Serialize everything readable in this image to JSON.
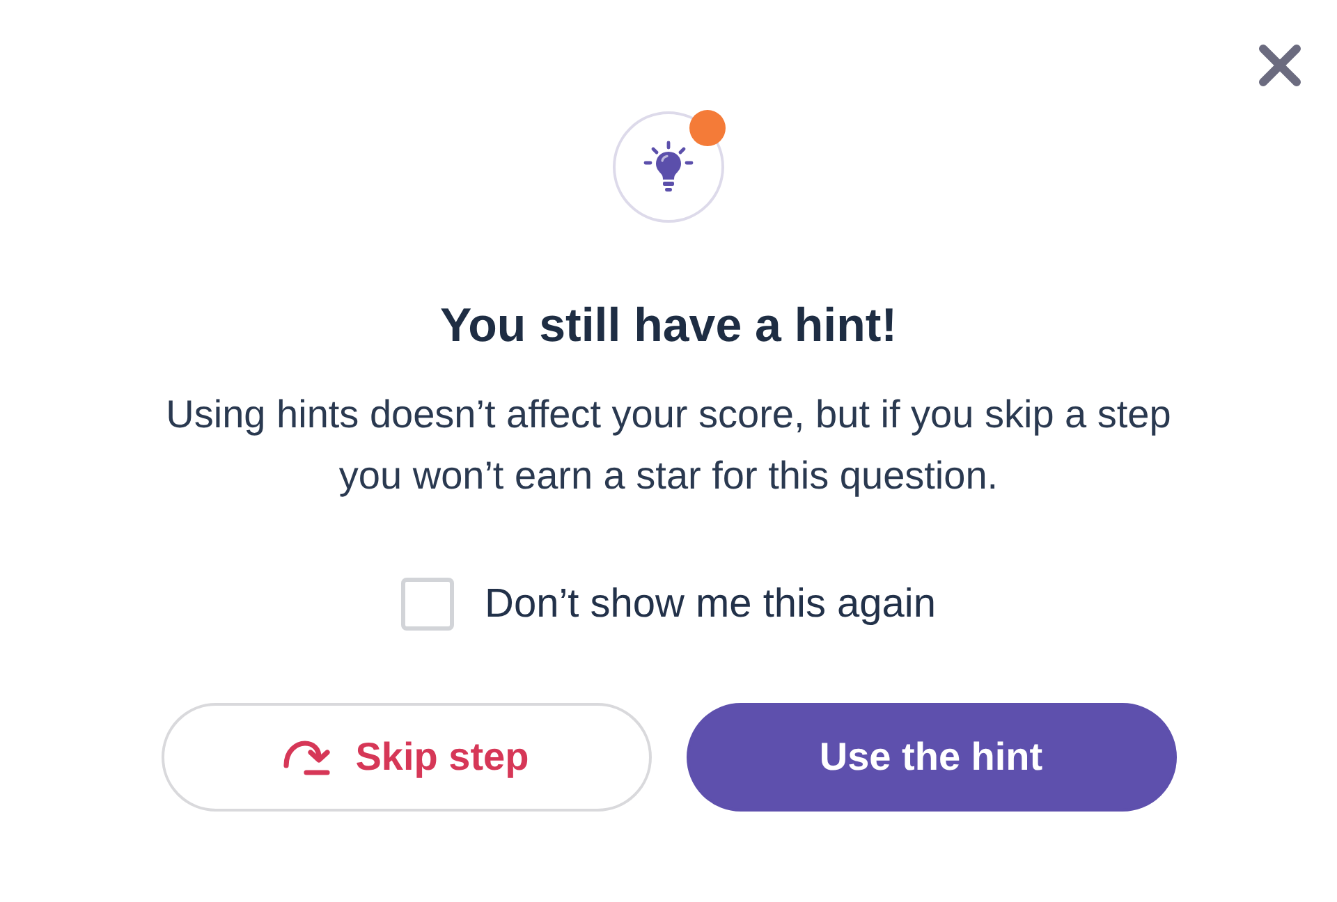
{
  "hint_icon": {
    "badge": true
  },
  "title": "You still have a hint!",
  "message": "Using hints doesn’t affect your score, but if you skip a step you won’t earn a star for this question.",
  "checkbox": {
    "label": "Don’t show me this again",
    "checked": false
  },
  "buttons": [
    {
      "label": "Skip step",
      "kind": "outline"
    },
    {
      "label": "Use the hint",
      "kind": "filled"
    }
  ]
}
